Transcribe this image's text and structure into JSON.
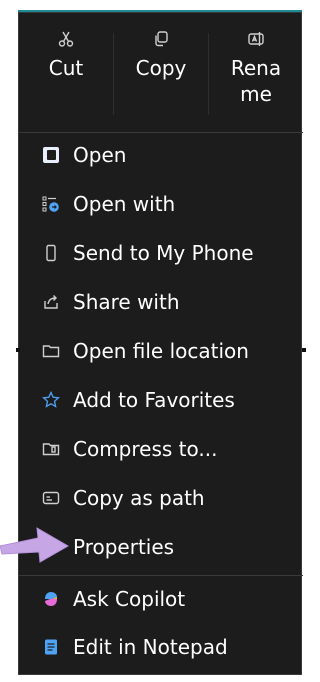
{
  "quick_actions": [
    {
      "label": "Cut",
      "icon": "scissors-icon"
    },
    {
      "label": "Copy",
      "icon": "copy-icon"
    },
    {
      "label": "Rena\nme",
      "icon": "rename-icon"
    }
  ],
  "items": [
    {
      "label": "Open",
      "icon": "open-app-icon"
    },
    {
      "label": "Open with",
      "icon": "open-with-icon"
    },
    {
      "label": "Send to My Phone",
      "icon": "phone-icon"
    },
    {
      "label": "Share with",
      "icon": "share-icon"
    },
    {
      "label": "Open file location",
      "icon": "folder-icon"
    },
    {
      "label": "Add to Favorites",
      "icon": "star-icon"
    },
    {
      "label": "Compress to...",
      "icon": "zip-folder-icon"
    },
    {
      "label": "Copy as path",
      "icon": "path-icon"
    },
    {
      "label": "Properties",
      "icon": "properties-icon"
    },
    {
      "label": "Ask Copilot",
      "icon": "copilot-icon"
    },
    {
      "label": "Edit in Notepad",
      "icon": "notepad-icon"
    }
  ],
  "colors": {
    "menu_bg": "#1c1c1c",
    "accent_blue": "#4fa3f7",
    "arrow": "#c7a6e6",
    "text": "#ffffff"
  }
}
